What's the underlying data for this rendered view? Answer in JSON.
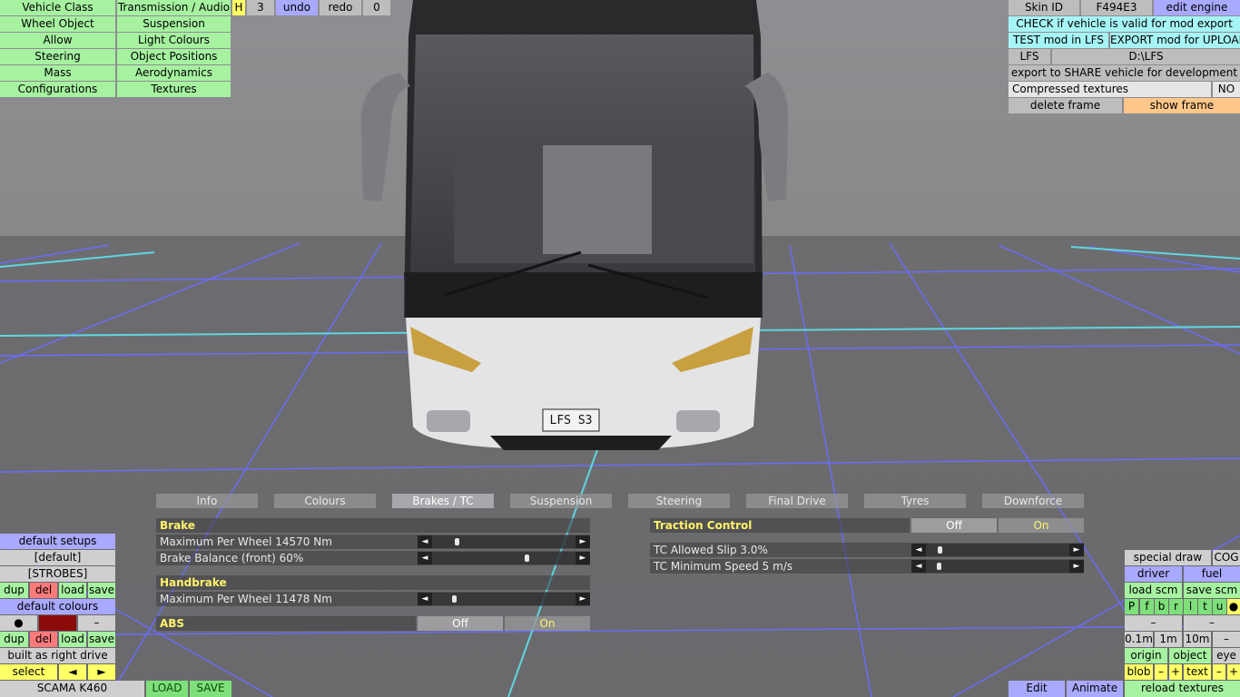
{
  "menu_left": {
    "vehicle_class": "Vehicle Class",
    "transmission": "Transmission / Audio",
    "h": "H",
    "three": "3",
    "undo": "undo",
    "redo": "redo",
    "zero": "0",
    "wheel_object": "Wheel Object",
    "suspension": "Suspension",
    "allow": "Allow",
    "light_colours": "Light Colours",
    "steering": "Steering",
    "object_positions": "Object Positions",
    "mass": "Mass",
    "aerodynamics": "Aerodynamics",
    "configurations": "Configurations",
    "textures": "Textures"
  },
  "menu_right": {
    "skin_id": "Skin ID",
    "skin_value": "F494E3",
    "edit_engine": "edit engine",
    "check": "CHECK if vehicle is valid for mod export",
    "test": "TEST mod in LFS",
    "export": "EXPORT mod for UPLOAD",
    "lfs": "LFS",
    "path": "D:\\LFS",
    "share": "export to SHARE vehicle for development",
    "compressed": "Compressed textures",
    "compressed_val": "NO",
    "delete_frame": "delete frame",
    "show_frame": "show frame"
  },
  "plate": "LFS S3",
  "tabs": [
    "Info",
    "Colours",
    "Brakes / TC",
    "Suspension",
    "Steering",
    "Final Drive",
    "Tyres",
    "Downforce"
  ],
  "brake": {
    "header": "Brake",
    "max_per_wheel": "Maximum Per Wheel 14570 Nm",
    "max_per_wheel_level": 0.1,
    "balance": "Brake Balance (front) 60%",
    "balance_level": 0.6,
    "handbrake_header": "Handbrake",
    "hb_max": "Maximum Per Wheel 11478 Nm",
    "hb_max_level": 0.08,
    "abs": "ABS",
    "abs_off": "Off",
    "abs_on": "On"
  },
  "tc": {
    "header": "Traction Control",
    "off": "Off",
    "on": "On",
    "slip": "TC Allowed Slip 3.0%",
    "slip_level": 0.02,
    "speed": "TC Minimum Speed 5 m/s",
    "speed_level": 0.01
  },
  "left_panel": {
    "default_setups": "default setups",
    "default": "[default]",
    "strobes": "[STROBES]",
    "dup": "dup",
    "del": "del",
    "load": "load",
    "save": "save",
    "default_colours": "default colours",
    "dot": "●",
    "dash": "–",
    "built": "built as right drive",
    "select": "select",
    "prev": "◄",
    "next": "►",
    "car_name": "SCAMA K460",
    "load_btn": "LOAD",
    "save_btn": "SAVE",
    "colour_swatch": "#8b0a0a"
  },
  "right_panel": {
    "special_draw": "special draw",
    "cog": "COG",
    "driver": "driver",
    "fuel": "fuel",
    "load_scm": "load scm",
    "save_scm": "save scm",
    "letters": [
      "P",
      "f",
      "b",
      "r",
      "l",
      "t",
      "u",
      "●"
    ],
    "dash": "–",
    "m01": "0.1m",
    "m1": "1m",
    "m10": "10m",
    "origin": "origin",
    "object": "object",
    "eye": "eye",
    "blob": "blob",
    "plus": "+",
    "text": "text",
    "edit": "Edit",
    "animate": "Animate",
    "reload": "reload textures"
  }
}
